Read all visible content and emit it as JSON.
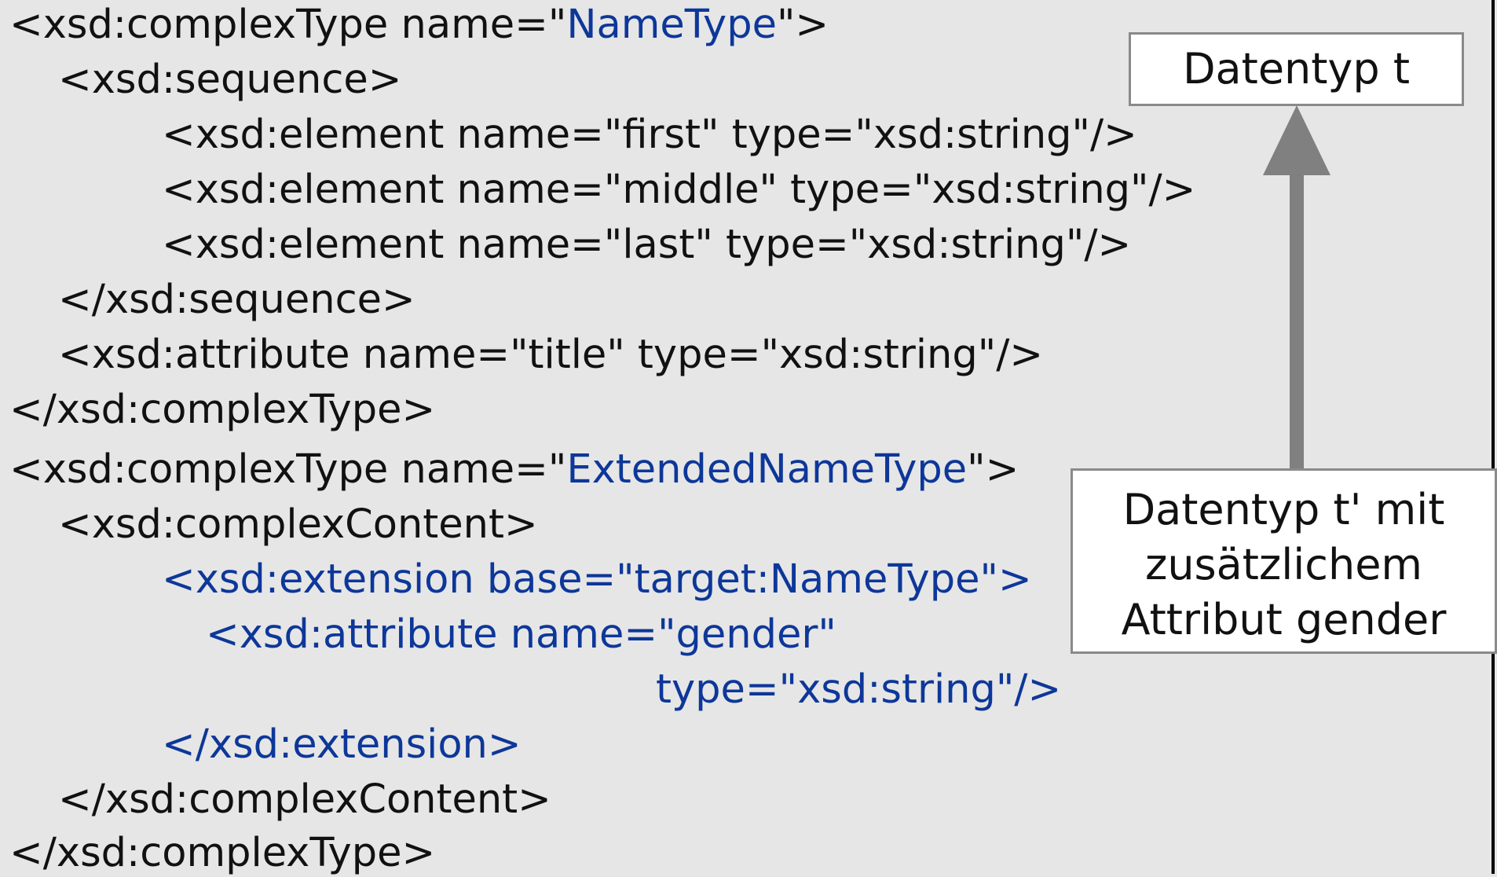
{
  "code": {
    "l1a": "<xsd:complexType name=\"",
    "l1b": "NameType",
    "l1c": "\">",
    "l2": "<xsd:sequence>",
    "l3": "<xsd:element name=\"first\" type=\"xsd:string\"/>",
    "l4": "<xsd:element name=\"middle\" type=\"xsd:string\"/>",
    "l5": "<xsd:element name=\"last\" type=\"xsd:string\"/>",
    "l6": "</xsd:sequence>",
    "l7": "<xsd:attribute name=\"title\" type=\"xsd:string\"/>",
    "l8": "</xsd:complexType>",
    "l9a": "<xsd:complexType name=\"",
    "l9b": "ExtendedNameType",
    "l9c": "\">",
    "l10": "<xsd:complexContent>",
    "l11": "<xsd:extension base=\"target:NameType\">",
    "l12": "<xsd:attribute name=\"gender\"",
    "l13": "type=\"xsd:string\"/>",
    "l14": "</xsd:extension>",
    "l15": "</xsd:complexContent>",
    "l16": "</xsd:complexType>"
  },
  "labels": {
    "datentyp_t": "Datentyp t",
    "datentyp_t2_line1": "Datentyp t' mit",
    "datentyp_t2_line2": "zusätzlichem",
    "datentyp_t2_line3": "Attribut gender"
  },
  "colors": {
    "highlight": "#0d3799",
    "text": "#111111",
    "background": "#e6e6e6",
    "arrow": "#808080"
  }
}
